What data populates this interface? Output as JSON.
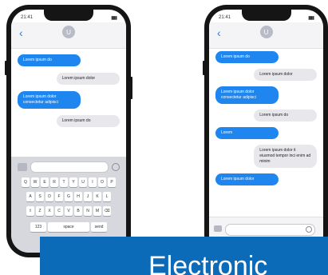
{
  "phones": [
    {
      "status_time": "21:41",
      "status_signal": "▮▮▮",
      "back_icon": "‹",
      "contact_initial": "U",
      "messages": [
        {
          "dir": "in",
          "text": "Lorem ipsum do"
        },
        {
          "dir": "out",
          "text": "Lorem ipsum dolor"
        },
        {
          "dir": "in",
          "text": "Lorem ipsum dolor consectetur adipisci"
        },
        {
          "dir": "out",
          "text": "Lorem ipsum do"
        }
      ],
      "keyboard": {
        "rows": [
          [
            "Q",
            "W",
            "E",
            "R",
            "T",
            "Y",
            "U",
            "I",
            "O",
            "P"
          ],
          [
            "A",
            "S",
            "D",
            "F",
            "G",
            "H",
            "J",
            "K",
            "L"
          ],
          [
            "Z",
            "X",
            "C",
            "V",
            "B",
            "N",
            "M"
          ]
        ],
        "bottom_left": "123",
        "space_label": "space",
        "return_label": "send"
      }
    },
    {
      "status_time": "21:41",
      "status_signal": "▮▮▮",
      "back_icon": "‹",
      "contact_initial": "U",
      "messages": [
        {
          "dir": "in",
          "text": "Lorem ipsum do"
        },
        {
          "dir": "out",
          "text": "Lorem ipsum dolor"
        },
        {
          "dir": "in",
          "text": "Lorem ipsum dolor consectetur adipisci"
        },
        {
          "dir": "out",
          "text": "Lorem ipsum do"
        },
        {
          "dir": "in",
          "text": "Lorem"
        },
        {
          "dir": "out",
          "text": "Lorem ipsum dolor it eiusmod tempor inci enim ad minim"
        },
        {
          "dir": "in",
          "text": "Lorem ipsum dolor"
        }
      ]
    }
  ],
  "banner": {
    "text": "Electronic"
  },
  "colors": {
    "accent": "#1f86f0",
    "banner": "#0b6bb8"
  }
}
